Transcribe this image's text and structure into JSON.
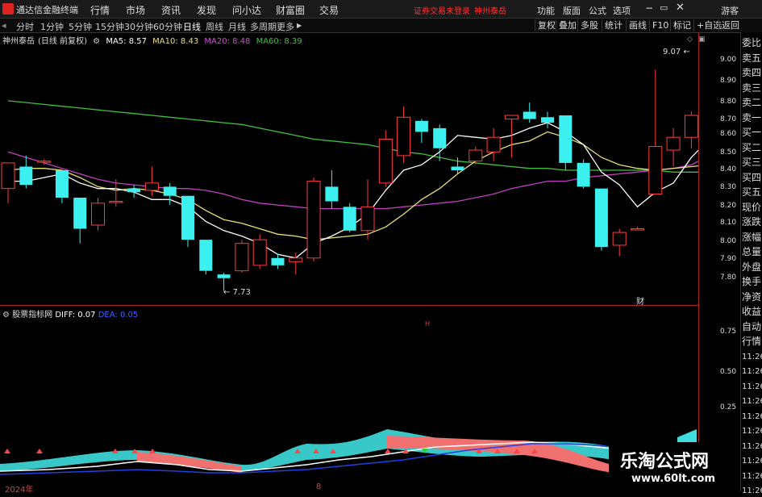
{
  "app": {
    "title": "通达信金融终端"
  },
  "menu": [
    "行情",
    "市场",
    "资讯",
    "发现",
    "问小达",
    "财富圈",
    "交易"
  ],
  "status": {
    "login": "证券交易未登录",
    "stock": "神州泰岳"
  },
  "right_menu": [
    "功能",
    "版面",
    "公式",
    "选项",
    "游客"
  ],
  "periods": [
    "分时",
    "1分钟",
    "5分钟",
    "15分钟",
    "30分钟",
    "60分钟",
    "日线",
    "周线",
    "月线",
    "多周期",
    "更多"
  ],
  "active_period": "日线",
  "toolbar_right": [
    "复权",
    "叠加",
    "多股",
    "统计",
    "画线",
    "F10",
    "标记",
    "+自选",
    "返回"
  ],
  "info": {
    "stock_name": "神州泰岳",
    "period_desc": "(日线 前复权)",
    "ma5": "MA5: 8.57",
    "ma10": "MA10: 8.43",
    "ma20": "MA20: 8.48",
    "ma60": "MA60: 8.39"
  },
  "price_axis": [
    "9.00",
    "8.90",
    "8.80",
    "8.70",
    "8.60",
    "8.50",
    "8.40",
    "8.30",
    "8.20",
    "8.10",
    "8.00",
    "7.90",
    "7.80"
  ],
  "annotations": {
    "high": "9.07",
    "low": "7.73",
    "cai": "财",
    "mid_mark": "H"
  },
  "indicator": {
    "name": "股票指标网",
    "diff": "DIFF: 0.07",
    "dea": "DEA: 0.05"
  },
  "ind_axis": [
    "0.75",
    "0.50",
    "0.25"
  ],
  "right_panel": [
    "委比",
    "卖五",
    "卖四",
    "卖三",
    "卖二",
    "卖一",
    "买一",
    "买二",
    "买三",
    "买四",
    "买五",
    "现价",
    "涨跌",
    "涨幅",
    "总量",
    "外盘",
    "换手",
    "净资",
    "收益"
  ],
  "right_panel2": [
    "自动",
    "行情",
    "11:26",
    "11:26",
    "11:26",
    "11:26",
    "11:26",
    "11:26",
    "11:26",
    "11:26",
    "11:26",
    "11:26"
  ],
  "date_label": "2024年",
  "watermark": {
    "line1": "乐淘公式网",
    "line2": "www.60lt.com"
  },
  "chart_data": {
    "type": "candlestick",
    "ylim": [
      7.7,
      9.1
    ],
    "candles": [
      [
        8.3,
        8.44,
        8.22,
        8.44
      ],
      [
        8.42,
        8.32,
        8.3,
        8.48
      ],
      [
        8.45,
        8.45,
        8.43,
        8.46
      ],
      [
        8.4,
        8.25,
        8.22,
        8.4
      ],
      [
        8.25,
        8.08,
        8.0,
        8.25
      ],
      [
        8.1,
        8.22,
        8.07,
        8.25
      ],
      [
        8.23,
        8.23,
        8.2,
        8.35
      ],
      [
        8.3,
        8.28,
        8.25,
        8.32
      ],
      [
        8.29,
        8.33,
        8.26,
        8.42
      ],
      [
        8.31,
        8.26,
        8.21,
        8.33
      ],
      [
        8.26,
        8.02,
        7.98,
        8.26
      ],
      [
        8.02,
        7.85,
        7.83,
        8.02
      ],
      [
        7.83,
        7.81,
        7.74,
        7.84
      ],
      [
        7.85,
        8.0,
        7.84,
        8.02
      ],
      [
        7.88,
        8.02,
        7.86,
        8.05
      ],
      [
        7.92,
        7.88,
        7.86,
        7.94
      ],
      [
        7.9,
        7.92,
        7.83,
        7.95
      ],
      [
        7.92,
        8.34,
        7.9,
        8.36
      ],
      [
        8.31,
        8.23,
        8.19,
        8.4
      ],
      [
        8.2,
        8.07,
        8.06,
        8.22
      ],
      [
        8.07,
        8.2,
        8.02,
        8.35
      ],
      [
        8.33,
        8.57,
        8.31,
        8.62
      ],
      [
        8.48,
        8.69,
        8.44,
        8.75
      ],
      [
        8.67,
        8.61,
        8.55,
        8.68
      ],
      [
        8.63,
        8.52,
        8.45,
        8.65
      ],
      [
        8.42,
        8.4,
        8.38,
        8.47
      ],
      [
        8.45,
        8.51,
        8.43,
        8.53
      ],
      [
        8.5,
        8.58,
        8.45,
        8.63
      ],
      [
        8.68,
        8.7,
        8.47,
        8.7
      ],
      [
        8.72,
        8.68,
        8.66,
        8.77
      ],
      [
        8.69,
        8.66,
        8.63,
        8.72
      ],
      [
        8.7,
        8.44,
        8.4,
        8.7
      ],
      [
        8.44,
        8.31,
        8.3,
        8.46
      ],
      [
        8.3,
        7.98,
        7.96,
        8.3
      ],
      [
        7.99,
        8.06,
        7.93,
        8.08
      ],
      [
        8.08,
        8.08,
        8.07,
        8.09
      ],
      [
        8.27,
        8.53,
        8.27,
        8.95
      ],
      [
        8.51,
        8.58,
        8.42,
        8.63
      ],
      [
        8.58,
        8.7,
        8.52,
        8.72
      ],
      [
        8.68,
        8.9,
        8.67,
        9.07
      ]
    ],
    "ma": [
      {
        "name": "MA5",
        "color": "#ffffff",
        "values": [
          8.34,
          8.34,
          8.36,
          8.38,
          8.33,
          8.3,
          8.3,
          8.28,
          8.24,
          8.24,
          8.2,
          8.12,
          8.07,
          8.04,
          8.0,
          7.94,
          7.92,
          8.0,
          8.04,
          8.09,
          8.16,
          8.29,
          8.4,
          8.43,
          8.5,
          8.59,
          8.58,
          8.57,
          8.59,
          8.63,
          8.66,
          8.61,
          8.54,
          8.39,
          8.32,
          8.2,
          8.28,
          8.33,
          8.47,
          8.57
        ]
      },
      {
        "name": "MA10",
        "color": "#e8e07a",
        "values": [
          8.4,
          8.41,
          8.41,
          8.4,
          8.36,
          8.31,
          8.29,
          8.3,
          8.29,
          8.27,
          8.24,
          8.18,
          8.13,
          8.11,
          8.08,
          8.05,
          8.04,
          8.02,
          8.03,
          8.04,
          8.05,
          8.09,
          8.16,
          8.24,
          8.3,
          8.38,
          8.45,
          8.5,
          8.54,
          8.56,
          8.61,
          8.58,
          8.54,
          8.47,
          8.43,
          8.41,
          8.4,
          8.41,
          8.42,
          8.43
        ]
      },
      {
        "name": "MA20",
        "color": "#c040c0",
        "values": [
          8.5,
          8.47,
          8.44,
          8.41,
          8.38,
          8.35,
          8.33,
          8.32,
          8.31,
          8.3,
          8.3,
          8.29,
          8.27,
          8.24,
          8.22,
          8.21,
          8.2,
          8.19,
          8.19,
          8.19,
          8.19,
          8.19,
          8.2,
          8.21,
          8.22,
          8.23,
          8.25,
          8.27,
          8.3,
          8.32,
          8.34,
          8.34,
          8.36,
          8.37,
          8.38,
          8.39,
          8.4,
          8.41,
          8.43,
          8.48
        ]
      },
      {
        "name": "MA60",
        "color": "#40c040",
        "values": [
          8.78,
          8.77,
          8.76,
          8.75,
          8.74,
          8.73,
          8.72,
          8.71,
          8.7,
          8.69,
          8.68,
          8.67,
          8.66,
          8.65,
          8.63,
          8.61,
          8.59,
          8.57,
          8.56,
          8.55,
          8.54,
          8.52,
          8.5,
          8.49,
          8.47,
          8.45,
          8.44,
          8.43,
          8.42,
          8.41,
          8.41,
          8.4,
          8.4,
          8.4,
          8.4,
          8.4,
          8.4,
          8.39,
          8.39,
          8.39
        ]
      }
    ]
  }
}
